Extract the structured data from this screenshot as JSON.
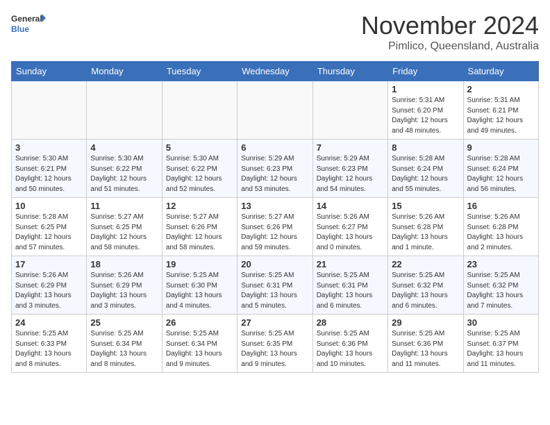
{
  "header": {
    "logo_general": "General",
    "logo_blue": "Blue",
    "month": "November 2024",
    "location": "Pimlico, Queensland, Australia"
  },
  "days_of_week": [
    "Sunday",
    "Monday",
    "Tuesday",
    "Wednesday",
    "Thursday",
    "Friday",
    "Saturday"
  ],
  "weeks": [
    [
      {
        "day": "",
        "info": ""
      },
      {
        "day": "",
        "info": ""
      },
      {
        "day": "",
        "info": ""
      },
      {
        "day": "",
        "info": ""
      },
      {
        "day": "",
        "info": ""
      },
      {
        "day": "1",
        "info": "Sunrise: 5:31 AM\nSunset: 6:20 PM\nDaylight: 12 hours\nand 48 minutes."
      },
      {
        "day": "2",
        "info": "Sunrise: 5:31 AM\nSunset: 6:21 PM\nDaylight: 12 hours\nand 49 minutes."
      }
    ],
    [
      {
        "day": "3",
        "info": "Sunrise: 5:30 AM\nSunset: 6:21 PM\nDaylight: 12 hours\nand 50 minutes."
      },
      {
        "day": "4",
        "info": "Sunrise: 5:30 AM\nSunset: 6:22 PM\nDaylight: 12 hours\nand 51 minutes."
      },
      {
        "day": "5",
        "info": "Sunrise: 5:30 AM\nSunset: 6:22 PM\nDaylight: 12 hours\nand 52 minutes."
      },
      {
        "day": "6",
        "info": "Sunrise: 5:29 AM\nSunset: 6:23 PM\nDaylight: 12 hours\nand 53 minutes."
      },
      {
        "day": "7",
        "info": "Sunrise: 5:29 AM\nSunset: 6:23 PM\nDaylight: 12 hours\nand 54 minutes."
      },
      {
        "day": "8",
        "info": "Sunrise: 5:28 AM\nSunset: 6:24 PM\nDaylight: 12 hours\nand 55 minutes."
      },
      {
        "day": "9",
        "info": "Sunrise: 5:28 AM\nSunset: 6:24 PM\nDaylight: 12 hours\nand 56 minutes."
      }
    ],
    [
      {
        "day": "10",
        "info": "Sunrise: 5:28 AM\nSunset: 6:25 PM\nDaylight: 12 hours\nand 57 minutes."
      },
      {
        "day": "11",
        "info": "Sunrise: 5:27 AM\nSunset: 6:25 PM\nDaylight: 12 hours\nand 58 minutes."
      },
      {
        "day": "12",
        "info": "Sunrise: 5:27 AM\nSunset: 6:26 PM\nDaylight: 12 hours\nand 58 minutes."
      },
      {
        "day": "13",
        "info": "Sunrise: 5:27 AM\nSunset: 6:26 PM\nDaylight: 12 hours\nand 59 minutes."
      },
      {
        "day": "14",
        "info": "Sunrise: 5:26 AM\nSunset: 6:27 PM\nDaylight: 13 hours\nand 0 minutes."
      },
      {
        "day": "15",
        "info": "Sunrise: 5:26 AM\nSunset: 6:28 PM\nDaylight: 13 hours\nand 1 minute."
      },
      {
        "day": "16",
        "info": "Sunrise: 5:26 AM\nSunset: 6:28 PM\nDaylight: 13 hours\nand 2 minutes."
      }
    ],
    [
      {
        "day": "17",
        "info": "Sunrise: 5:26 AM\nSunset: 6:29 PM\nDaylight: 13 hours\nand 3 minutes."
      },
      {
        "day": "18",
        "info": "Sunrise: 5:26 AM\nSunset: 6:29 PM\nDaylight: 13 hours\nand 3 minutes."
      },
      {
        "day": "19",
        "info": "Sunrise: 5:25 AM\nSunset: 6:30 PM\nDaylight: 13 hours\nand 4 minutes."
      },
      {
        "day": "20",
        "info": "Sunrise: 5:25 AM\nSunset: 6:31 PM\nDaylight: 13 hours\nand 5 minutes."
      },
      {
        "day": "21",
        "info": "Sunrise: 5:25 AM\nSunset: 6:31 PM\nDaylight: 13 hours\nand 6 minutes."
      },
      {
        "day": "22",
        "info": "Sunrise: 5:25 AM\nSunset: 6:32 PM\nDaylight: 13 hours\nand 6 minutes."
      },
      {
        "day": "23",
        "info": "Sunrise: 5:25 AM\nSunset: 6:32 PM\nDaylight: 13 hours\nand 7 minutes."
      }
    ],
    [
      {
        "day": "24",
        "info": "Sunrise: 5:25 AM\nSunset: 6:33 PM\nDaylight: 13 hours\nand 8 minutes."
      },
      {
        "day": "25",
        "info": "Sunrise: 5:25 AM\nSunset: 6:34 PM\nDaylight: 13 hours\nand 8 minutes."
      },
      {
        "day": "26",
        "info": "Sunrise: 5:25 AM\nSunset: 6:34 PM\nDaylight: 13 hours\nand 9 minutes."
      },
      {
        "day": "27",
        "info": "Sunrise: 5:25 AM\nSunset: 6:35 PM\nDaylight: 13 hours\nand 9 minutes."
      },
      {
        "day": "28",
        "info": "Sunrise: 5:25 AM\nSunset: 6:36 PM\nDaylight: 13 hours\nand 10 minutes."
      },
      {
        "day": "29",
        "info": "Sunrise: 5:25 AM\nSunset: 6:36 PM\nDaylight: 13 hours\nand 11 minutes."
      },
      {
        "day": "30",
        "info": "Sunrise: 5:25 AM\nSunset: 6:37 PM\nDaylight: 13 hours\nand 11 minutes."
      }
    ]
  ]
}
